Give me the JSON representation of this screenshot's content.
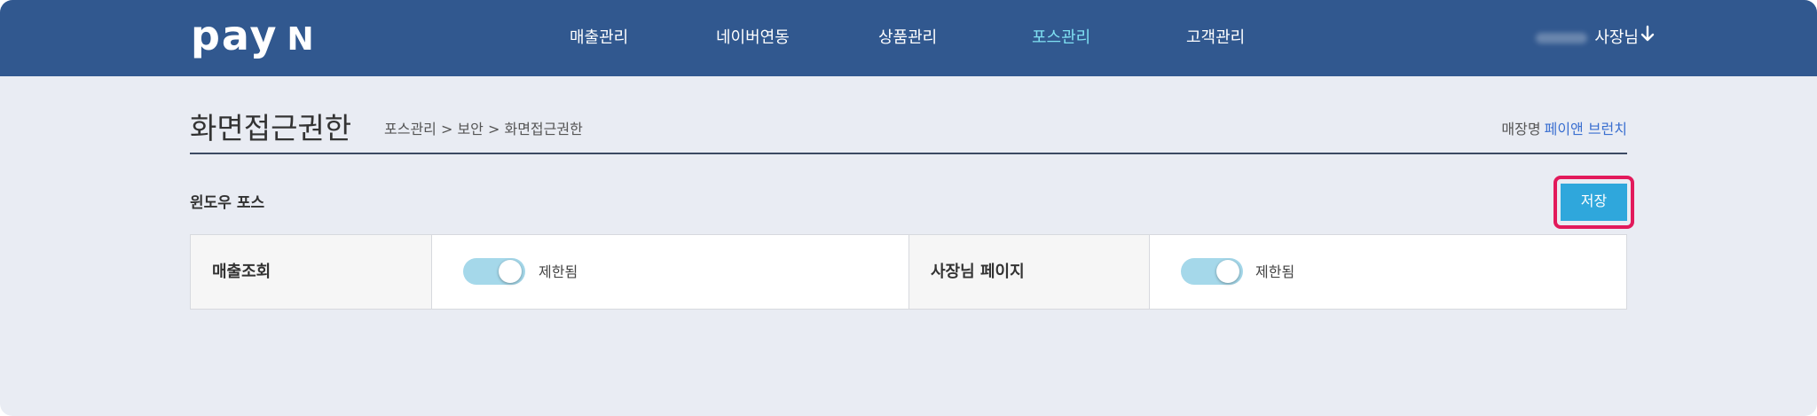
{
  "header": {
    "logo_text_pay": "pay",
    "logo_text_n": "N",
    "nav": [
      {
        "label": "매출관리",
        "active": false
      },
      {
        "label": "네이버연동",
        "active": false
      },
      {
        "label": "상품관리",
        "active": false
      },
      {
        "label": "포스관리",
        "active": true
      },
      {
        "label": "고객관리",
        "active": false
      }
    ],
    "user_label": "사장님",
    "user_menu_icon": "arrow-down-icon"
  },
  "page": {
    "title": "화면접근권한",
    "breadcrumb": "포스관리 > 보안 > 화면접근권한",
    "store_label": "매장명",
    "store_name": "페이앤 브런치"
  },
  "section": {
    "title": "윈도우 포스",
    "save_label": "저장"
  },
  "permissions": [
    {
      "label": "매출조회",
      "toggle_on": true,
      "status": "제한됨"
    },
    {
      "label": "사장님 페이지",
      "toggle_on": true,
      "status": "제한됨"
    }
  ],
  "colors": {
    "topbar": "#31588f",
    "active_nav": "#7fe0f2",
    "save_button": "#2fa7dc",
    "highlight": "#e21a5b",
    "toggle_track": "#a5d8ea",
    "store_name": "#3a6fd0"
  }
}
